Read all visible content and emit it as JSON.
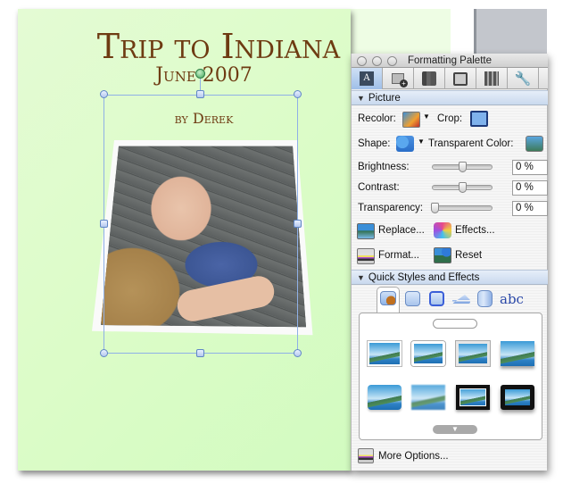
{
  "document": {
    "title": "Trip to Indiana",
    "date": "June 2007",
    "byline": "by Derek",
    "background_color": "#dcfcc8",
    "text_color": "#6e3b12"
  },
  "palette": {
    "title": "Formatting Palette",
    "toolbar_tabs": [
      {
        "icon": "text-box-icon",
        "active": true
      },
      {
        "icon": "add-picture-icon",
        "active": false
      },
      {
        "icon": "object-stack-icon",
        "active": false
      },
      {
        "icon": "scrapbook-icon",
        "active": false
      },
      {
        "icon": "reference-tools-icon",
        "active": false
      },
      {
        "icon": "toolbox-wrench-icon",
        "active": false
      }
    ],
    "picture_section": {
      "header": "Picture",
      "recolor_label": "Recolor:",
      "crop_label": "Crop:",
      "shape_label": "Shape:",
      "transparent_color_label": "Transparent Color:",
      "brightness_label": "Brightness:",
      "brightness_value": "0 %",
      "brightness_level": 0.5,
      "contrast_label": "Contrast:",
      "contrast_value": "0 %",
      "contrast_level": 0.5,
      "transparency_label": "Transparency:",
      "transparency_value": "0 %",
      "transparency_level": 0.0,
      "replace_label": "Replace...",
      "effects_label": "Effects...",
      "format_label": "Format...",
      "reset_label": "Reset"
    },
    "quick_styles_section": {
      "header": "Quick Styles and Effects",
      "tabs": [
        "picture-styles-icon",
        "shadows-icon",
        "glows-icon",
        "reflections-icon",
        "3d-effects-icon",
        "text-styles-icon"
      ],
      "text_tab_label": "abc",
      "style_count": 8
    },
    "more_options_label": "More Options..."
  }
}
